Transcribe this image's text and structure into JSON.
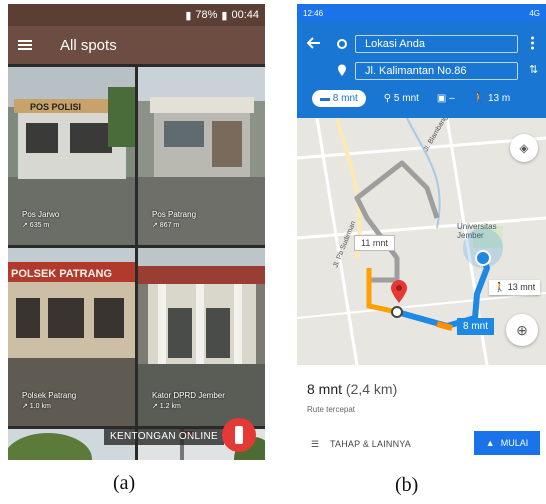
{
  "phone_a": {
    "status": {
      "battery": "78%",
      "time": "00:44"
    },
    "title": "All spots",
    "spots": [
      {
        "name": "Pos Jarwo",
        "dist": "↗ 635 m"
      },
      {
        "name": "Pos Patrang",
        "dist": "↗ 867 m"
      },
      {
        "name": "Polsek Patrang",
        "dist": "↗ 1.0 km"
      },
      {
        "name": "Kator DPRD Jember",
        "dist": "↗ 1.2 km"
      }
    ],
    "sign_pos_polisi": "POS POLISI",
    "sign_polsek": "POLSEK PATRANG",
    "banner": "KENTONGAN ONLINE",
    "caption": "(a)"
  },
  "phone_b": {
    "status": {
      "time": "12:46",
      "right": "4G"
    },
    "origin": "Lokasi Anda",
    "destination": "Jl. Kalimantan No.86",
    "modes": {
      "car": "8 mnt",
      "moto": "5 mnt",
      "transit": "–",
      "walk": "13 m"
    },
    "map": {
      "alt_route_time": "11 mnt",
      "route_time": "8 mnt",
      "walk_time": "13 mnt",
      "place": "Universitas Jember",
      "road1": "Jl. Blambangan",
      "road2": "Jl. Pb Sudirman"
    },
    "duration": "8 mnt",
    "distance": "(2,4 km)",
    "route_note": "Rute tercepat",
    "steps_label": "TAHAP & LAINNYA",
    "start_label": "MULAI",
    "caption": "(b)"
  }
}
